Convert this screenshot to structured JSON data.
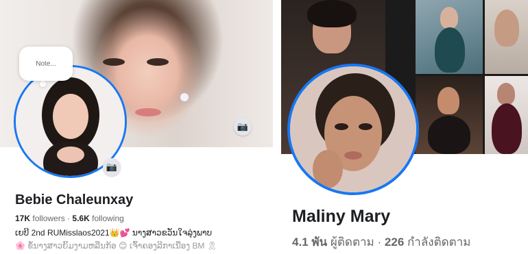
{
  "left_profile": {
    "name": "Bebie Chaleunxay",
    "note_placeholder": "Note...",
    "followers_count": "17K",
    "followers_label": "followers",
    "separator": "·",
    "following_count": "5.6K",
    "following_label": "following",
    "bio_line1": "ເຍບີ 2nd RUMisslaos2021👑💕 ນາງສາວຂວັນໃຈລຸ່ງພາບ",
    "bio_line2": "🌸 ຂໍ້ນາງສາວຍິ້ມງາມ​ຫລືນ​ກ້ອ 😊 ເຈົ້າຄອງລີ​ກາ​ເນື່ອງ BM 🎗"
  },
  "right_profile": {
    "name": "Maliny Mary",
    "followers_count": "4.1 พัน",
    "followers_label": "ผู้ติดตาม",
    "separator": "·",
    "following_count": "226",
    "following_label": "กำลังติดตาม"
  },
  "icons": {
    "camera": "camera-icon"
  },
  "colors": {
    "story_ring": "#1877f2",
    "camera_button_bg": "#e4e6eb",
    "secondary_text": "#65676b"
  }
}
